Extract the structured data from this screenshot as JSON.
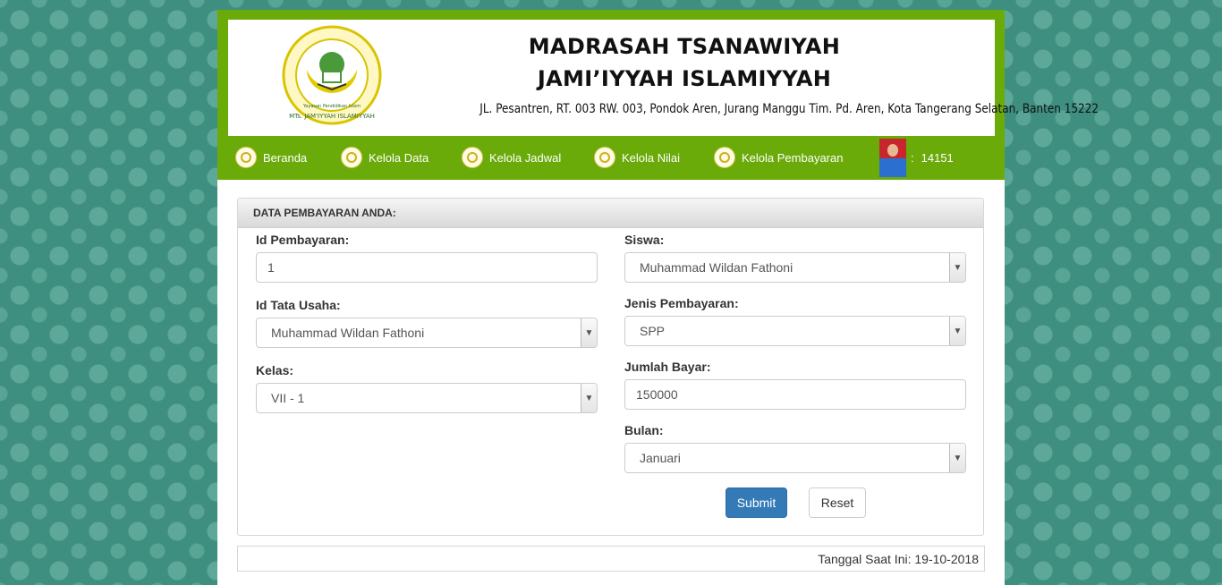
{
  "header": {
    "title_line1": "MADRASAH TSANAWIYAH",
    "title_line2": "JAMI’IYYAH ISLAMIYYAH",
    "address": "JL. Pesantren, RT. 003 RW. 003, Pondok Aren, Jurang Manggu Tim. Pd. Aren, Kota Tangerang Selatan, Banten 15222",
    "logo_text": "MTs. JAM'IYYAH ISLAMIYYAH",
    "logo_subtext": "Yayasan Pendidikan Islam"
  },
  "nav": {
    "items": [
      {
        "label": "Beranda"
      },
      {
        "label": "Kelola Data"
      },
      {
        "label": "Kelola Jadwal"
      },
      {
        "label": "Kelola Nilai"
      },
      {
        "label": "Kelola Pembayaran"
      }
    ],
    "user_separator": ":",
    "user_id": "14151"
  },
  "panel": {
    "heading": "DATA PEMBAYARAN ANDA:"
  },
  "form": {
    "id_pembayaran": {
      "label": "Id Pembayaran:",
      "value": "1"
    },
    "id_tata_usaha": {
      "label": "Id Tata Usaha:",
      "value": "Muhammad Wildan Fathoni"
    },
    "kelas": {
      "label": "Kelas:",
      "value": "VII - 1"
    },
    "siswa": {
      "label": "Siswa:",
      "value": "Muhammad Wildan Fathoni"
    },
    "jenis_pembayaran": {
      "label": "Jenis Pembayaran:",
      "value": "SPP"
    },
    "jumlah_bayar": {
      "label": "Jumlah Bayar:",
      "value": "150000"
    },
    "bulan": {
      "label": "Bulan:",
      "value": "Januari"
    },
    "submit_label": "Submit",
    "reset_label": "Reset"
  },
  "footer": {
    "date_text": "Tanggal Saat Ini: 19-10-2018"
  },
  "colors": {
    "green": "#6aab0a",
    "background": "#3f8f80",
    "primary_button": "#337ab7"
  }
}
